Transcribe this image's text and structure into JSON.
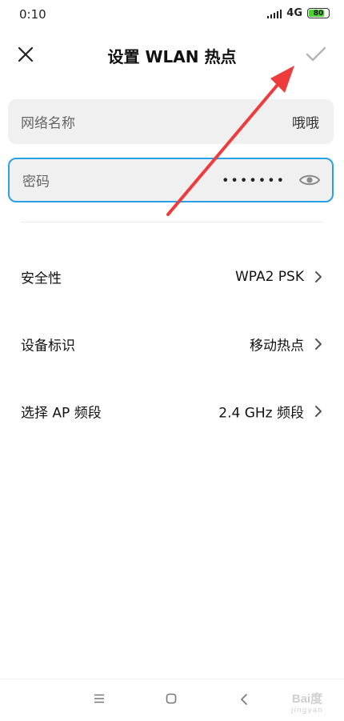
{
  "status_bar": {
    "time": "0:10",
    "network": "4G",
    "battery": "80"
  },
  "header": {
    "title": "设置 WLAN 热点"
  },
  "hotspot": {
    "name_label": "网络名称",
    "name_value": "哦哦",
    "password_label": "密码",
    "password_masked": "•••••••"
  },
  "settings": [
    {
      "label": "安全性",
      "value": "WPA2 PSK"
    },
    {
      "label": "设备标识",
      "value": "移动热点"
    },
    {
      "label": "选择 AP 频段",
      "value": "2.4 GHz 频段"
    }
  ],
  "watermark": {
    "logo": "Bai度",
    "sub": "jingyan"
  },
  "colors": {
    "focus_border": "#2aa0e6",
    "field_bg": "#f0f0f0",
    "annotation": "#ee3b3b",
    "battery_fill": "#4cd137"
  },
  "battery_level": 0.8
}
